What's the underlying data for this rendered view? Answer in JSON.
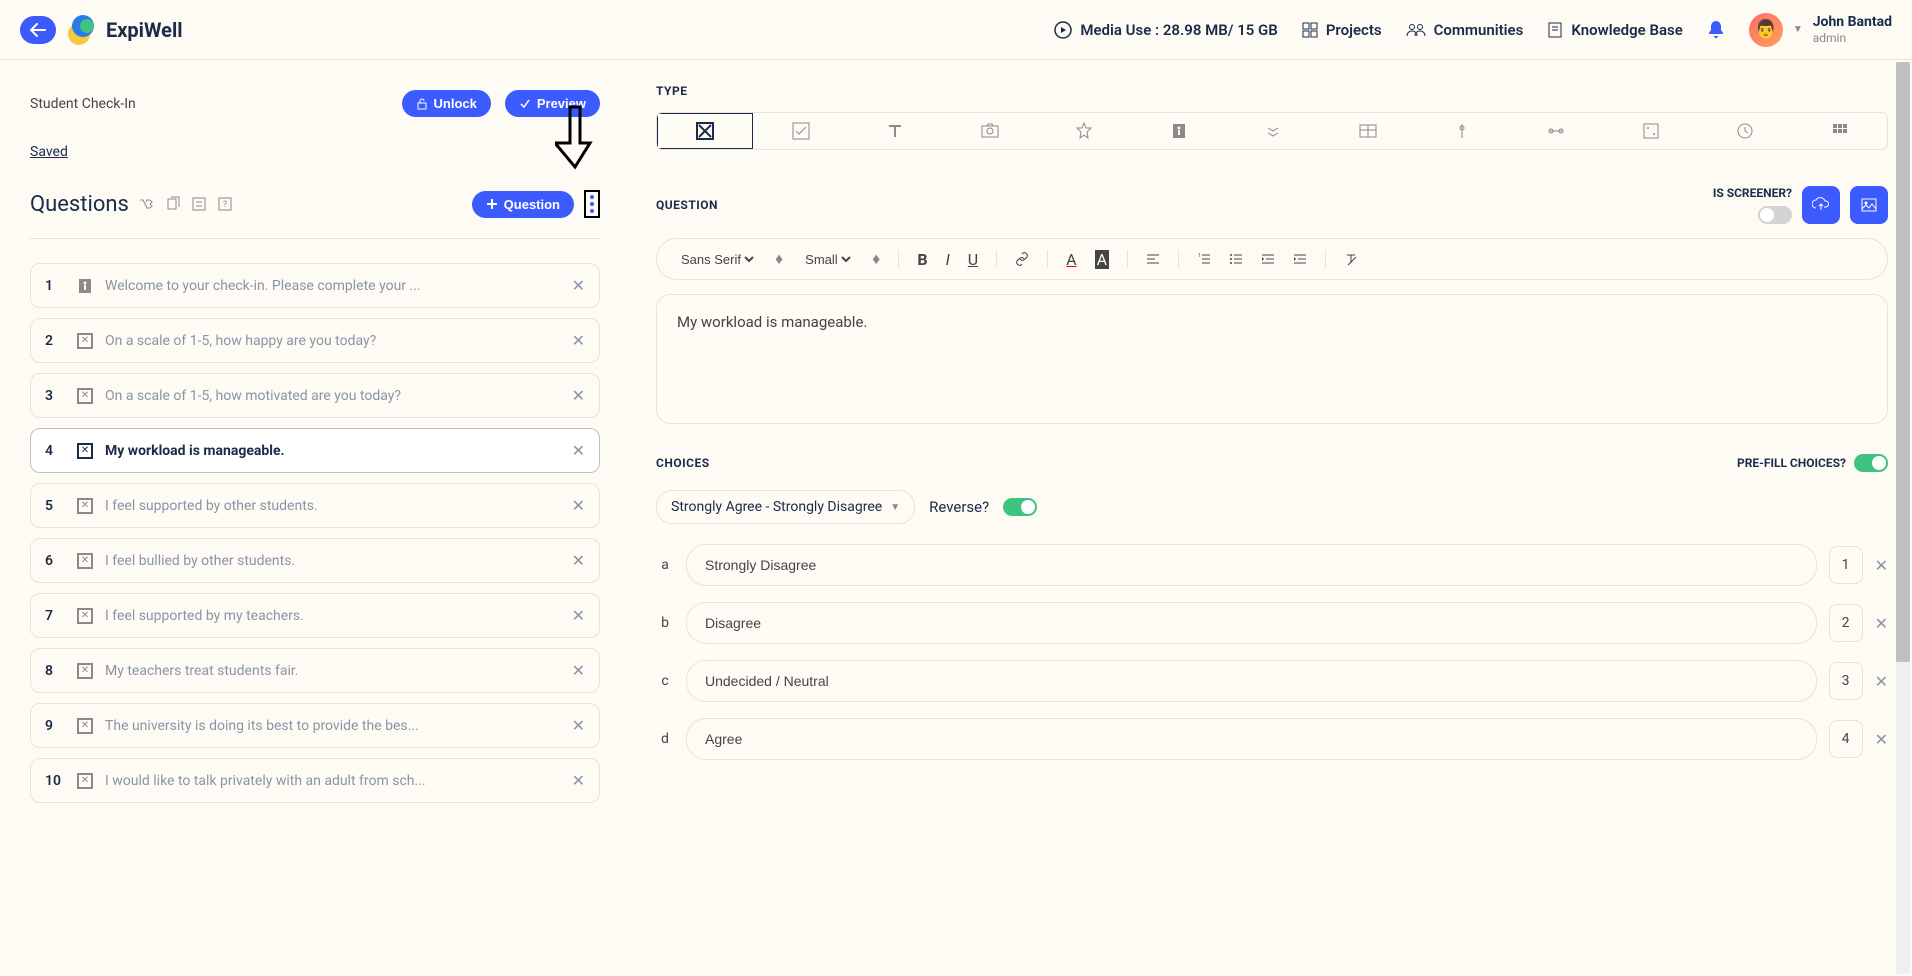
{
  "topbar": {
    "logo_text": "ExpiWell",
    "media_use": "Media Use : 28.98 MB/ 15 GB",
    "nav": {
      "projects": "Projects",
      "communities": "Communities",
      "knowledge_base": "Knowledge Base"
    },
    "user": {
      "name": "John Bantad",
      "role": "admin"
    }
  },
  "left": {
    "project_title": "Student Check-In",
    "unlock_label": "Unlock",
    "preview_label": "Preview",
    "saved_label": "Saved",
    "questions_title": "Questions",
    "add_question_label": "Question",
    "questions": [
      {
        "num": "1",
        "text": "Welcome to your check-in. Please complete your ...",
        "type": "info"
      },
      {
        "num": "2",
        "text": "On a scale of 1-5, how happy are you today?",
        "type": "radio"
      },
      {
        "num": "3",
        "text": "On a scale of 1-5, how motivated are you today?",
        "type": "radio"
      },
      {
        "num": "4",
        "text": "My workload is manageable.",
        "type": "radio",
        "active": true
      },
      {
        "num": "5",
        "text": "I feel supported by other students.",
        "type": "radio"
      },
      {
        "num": "6",
        "text": "I feel bullied by other students.",
        "type": "radio"
      },
      {
        "num": "7",
        "text": "I feel supported by my teachers.",
        "type": "radio"
      },
      {
        "num": "8",
        "text": "My teachers treat students fair.",
        "type": "radio"
      },
      {
        "num": "9",
        "text": "The university is doing its best to provide the bes...",
        "type": "radio"
      },
      {
        "num": "10",
        "text": "I would like to talk privately with an adult from sch...",
        "type": "radio"
      }
    ]
  },
  "right": {
    "type_label": "TYPE",
    "question_label": "QUESTION",
    "is_screener_label": "IS SCREENER?",
    "editor": {
      "font_family": "Sans Serif",
      "font_size": "Small",
      "content": "My workload is manageable."
    },
    "choices_label": "CHOICES",
    "prefill_label": "PRE-FILL CHOICES?",
    "choice_type": "Strongly Agree - Strongly Disagree",
    "reverse_label": "Reverse?",
    "choices": [
      {
        "letter": "a",
        "text": "Strongly Disagree",
        "num": "1"
      },
      {
        "letter": "b",
        "text": "Disagree",
        "num": "2"
      },
      {
        "letter": "c",
        "text": "Undecided / Neutral",
        "num": "3"
      },
      {
        "letter": "d",
        "text": "Agree",
        "num": "4"
      }
    ]
  }
}
